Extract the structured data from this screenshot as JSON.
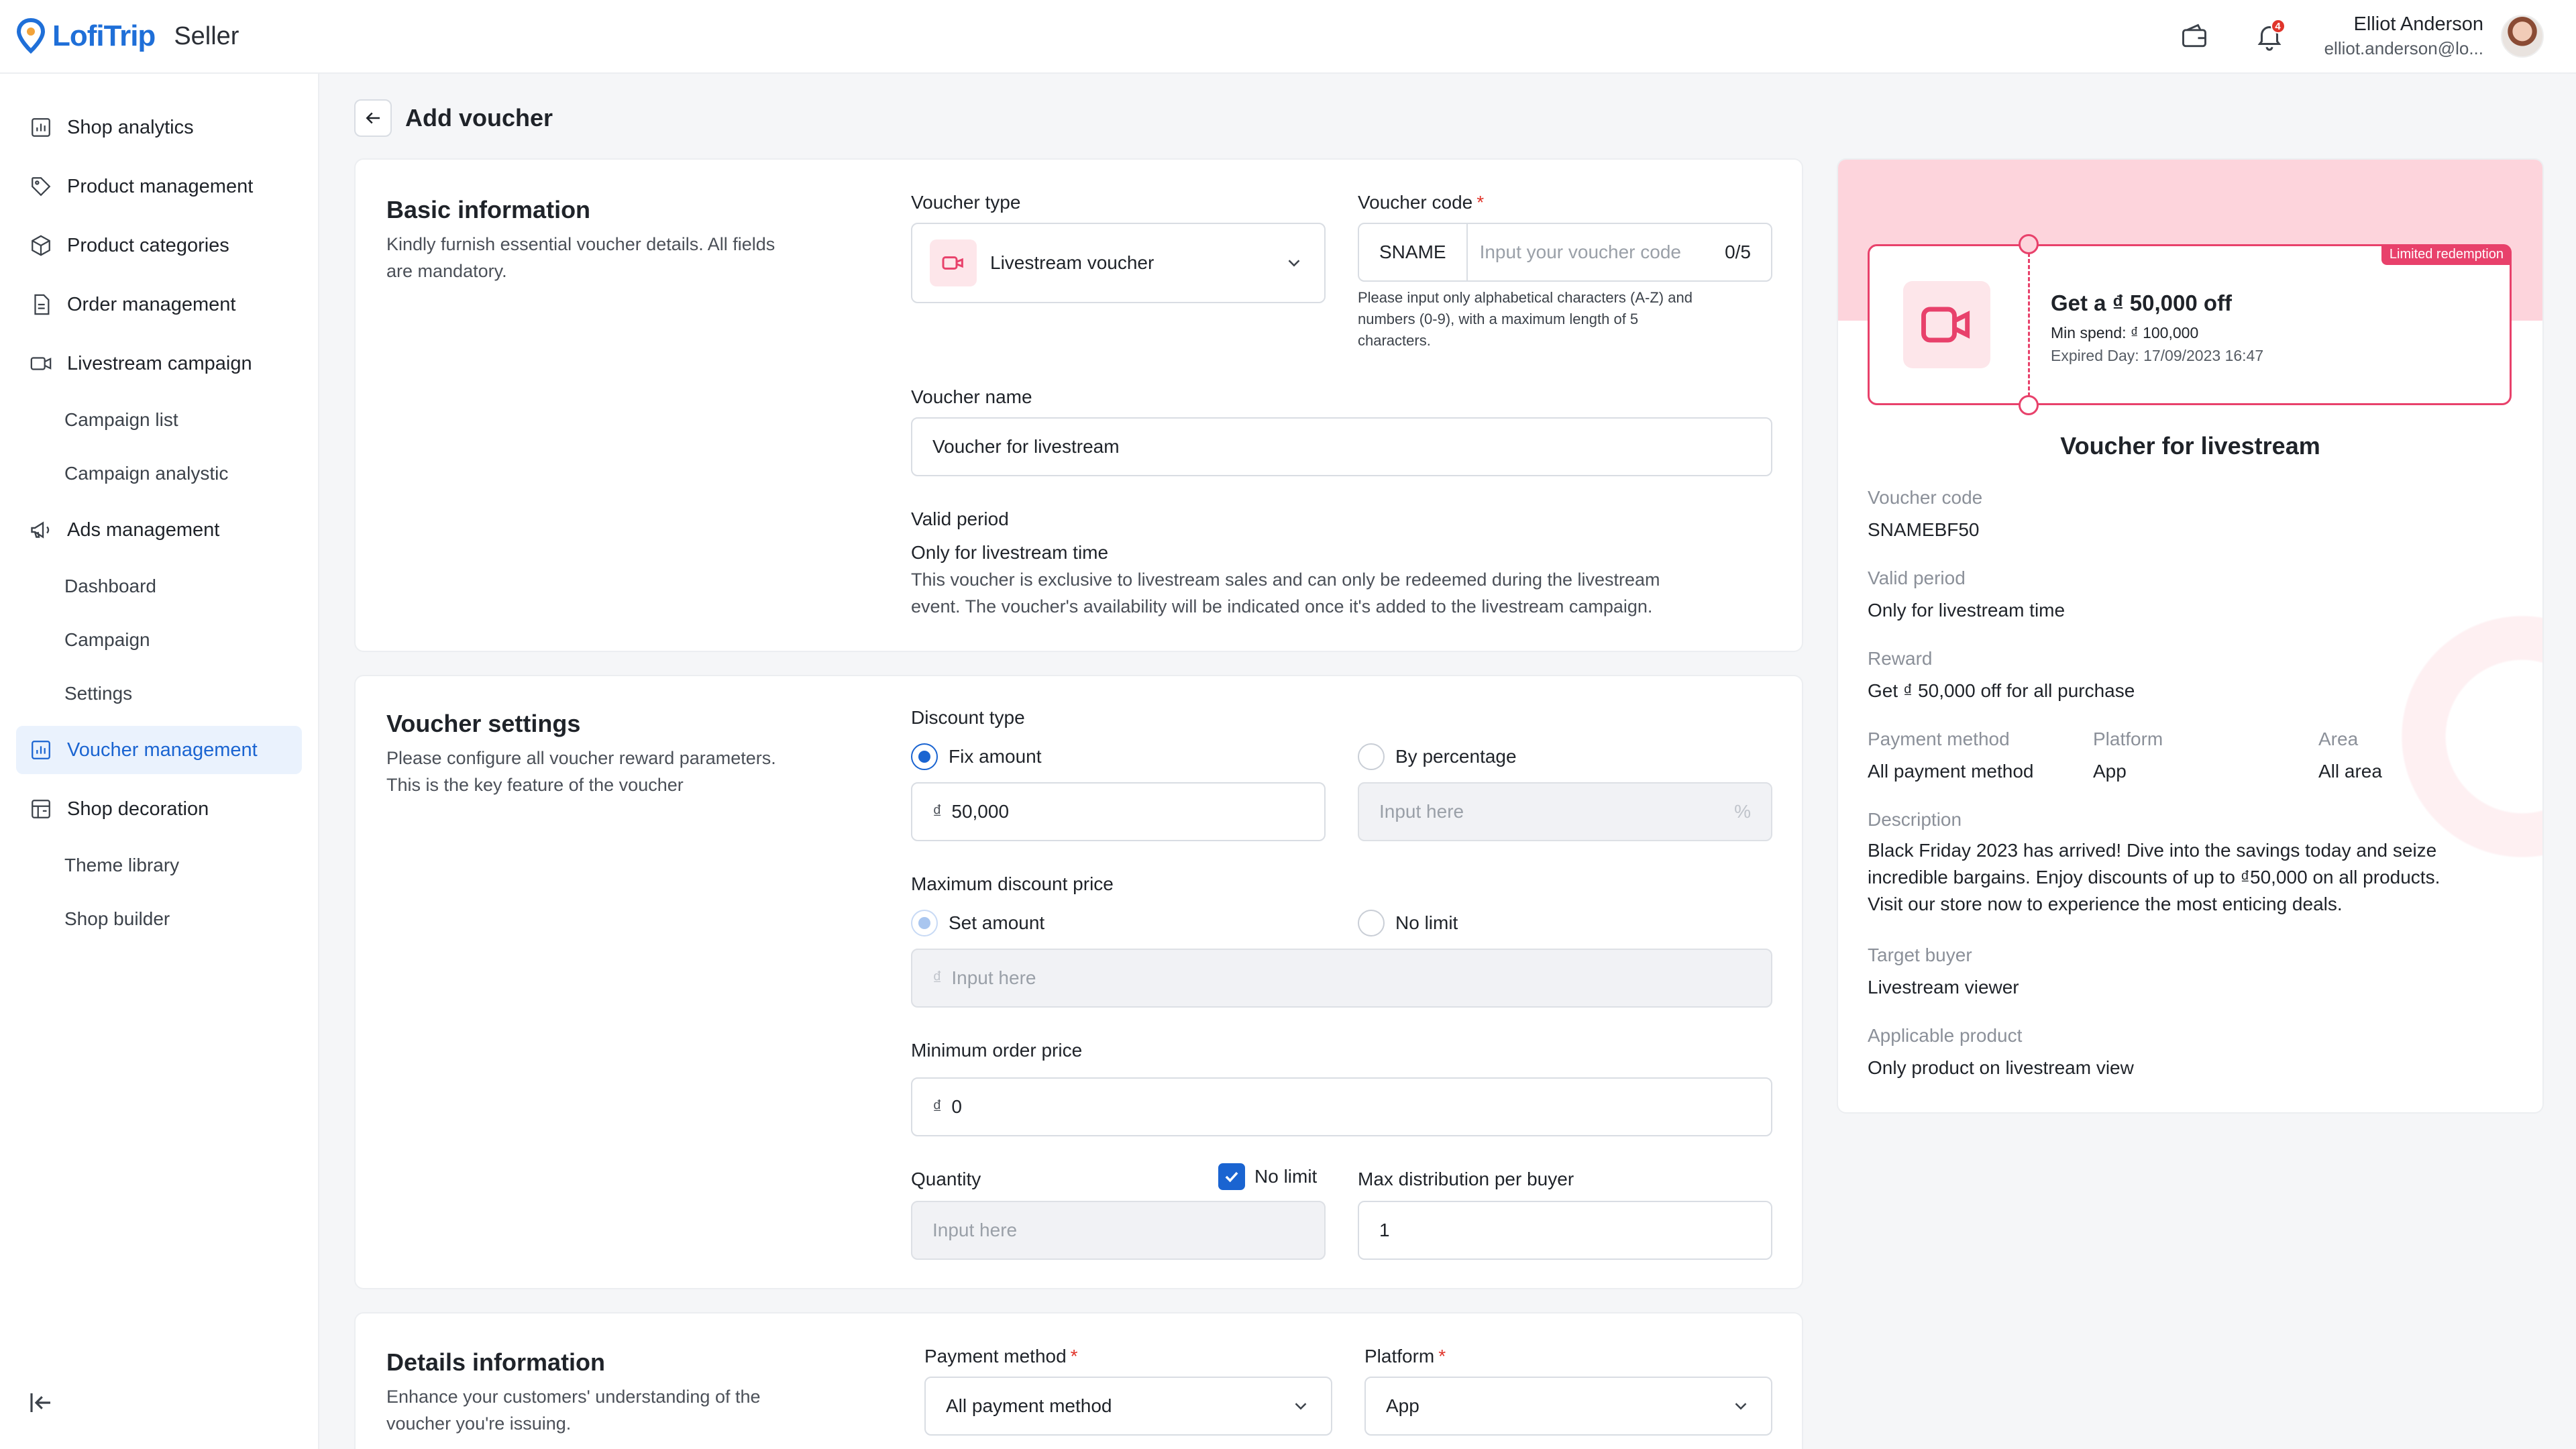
{
  "header": {
    "logo_text": "LofiTrip",
    "app_label": "Seller",
    "notification_count": "4",
    "user_name": "Elliot Anderson",
    "user_email": "elliot.anderson@lo..."
  },
  "sidebar": {
    "items": [
      {
        "label": "Shop analytics",
        "icon": "chart-icon"
      },
      {
        "label": "Product management",
        "icon": "tag-icon"
      },
      {
        "label": "Product categories",
        "icon": "box-icon"
      },
      {
        "label": "Order management",
        "icon": "document-icon"
      },
      {
        "label": "Livestream campaign",
        "icon": "video-icon"
      },
      {
        "label": "Campaign list"
      },
      {
        "label": "Campaign analystic"
      },
      {
        "label": "Ads management",
        "icon": "megaphone-icon"
      },
      {
        "label": "Dashboard"
      },
      {
        "label": "Campaign"
      },
      {
        "label": "Settings"
      },
      {
        "label": "Voucher management",
        "icon": "chart-icon",
        "active": true
      },
      {
        "label": "Shop decoration",
        "icon": "store-icon"
      },
      {
        "label": "Theme library"
      },
      {
        "label": "Shop builder"
      }
    ]
  },
  "page": {
    "title": "Add voucher"
  },
  "basic": {
    "title": "Basic information",
    "desc_line1": "Kindly furnish essential voucher details. All fields",
    "desc_line2": "are mandatory.",
    "voucher_type_label": "Voucher type",
    "voucher_type_value": "Livestream voucher",
    "voucher_code_label": "Voucher code",
    "code_prefix": "SNAME",
    "code_placeholder": "Input your voucher code",
    "code_counter": "0/5",
    "code_hint_1": "Please input only alphabetical characters (A-Z) and",
    "code_hint_2": "numbers (0-9), with a maximum length of 5",
    "code_hint_3": "characters.",
    "voucher_name_label": "Voucher name",
    "voucher_name_value": "Voucher for livestream",
    "valid_period_label": "Valid period",
    "valid_period_value": "Only for livestream time",
    "valid_period_desc_1": "This voucher is exclusive to livestream sales and can only be redeemed during the livestream",
    "valid_period_desc_2": "event. The voucher's availability will be indicated once it's added to the livestream campaign."
  },
  "settings": {
    "title": "Voucher settings",
    "desc_line1": "Please configure all voucher reward parameters.",
    "desc_line2": "This is the key feature of the voucher",
    "discount_type_label": "Discount type",
    "fix_amount_label": "Fix amount",
    "by_percentage_label": "By percentage",
    "currency": "₫",
    "fix_amount_value": "50,000",
    "percentage_placeholder": "Input here",
    "percent_sign": "%",
    "max_discount_label": "Maximum discount price",
    "set_amount_label": "Set amount",
    "no_limit_label": "No limit",
    "max_discount_placeholder": "Input here",
    "min_order_label": "Minimum order price",
    "min_order_value": "0",
    "quantity_label": "Quantity",
    "quantity_no_limit_label": "No limit",
    "quantity_placeholder": "Input here",
    "max_distribution_label": "Max distribution per buyer",
    "max_distribution_value": "1"
  },
  "details": {
    "title": "Details information",
    "desc_line1": "Enhance your customers' understanding of the",
    "desc_line2": "voucher you're issuing.",
    "payment_label": "Payment method",
    "payment_value": "All payment method",
    "platform_label": "Platform",
    "platform_value": "App"
  },
  "preview": {
    "tag": "Limited redemption",
    "ticket_title": "Get a ₫ 50,000 off",
    "min_spend_label": "Min spend:",
    "min_spend_value": "₫ 100,000",
    "expired_label": "Expired Day:",
    "expired_value": "17/09/2023 16:47",
    "name": "Voucher for livestream",
    "code_label": "Voucher code",
    "code_value": "SNAMEBF50",
    "valid_label": "Valid period",
    "valid_value": "Only for livestream time",
    "reward_label": "Reward",
    "reward_value": "Get ₫ 50,000 off for all purchase",
    "payment_label": "Payment method",
    "payment_value": "All payment method",
    "platform_label": "Platform",
    "platform_value": "App",
    "area_label": "Area",
    "area_value": "All area",
    "desc_label": "Description",
    "desc_1": "Black Friday 2023 has arrived! Dive into the savings today and seize",
    "desc_2": "incredible bargains. Enjoy discounts of up to ₫50,000 on all products.",
    "desc_3": "Visit our store now to experience the most enticing deals.",
    "target_label": "Target buyer",
    "target_value": "Livestream viewer",
    "applicable_label": "Applicable product",
    "applicable_value": "Only product on livestream view"
  },
  "colors": {
    "primary": "#1a64d1",
    "accent_pink": "#e8416b",
    "pink_band": "#fdd4dc",
    "required": "#e0352b"
  }
}
